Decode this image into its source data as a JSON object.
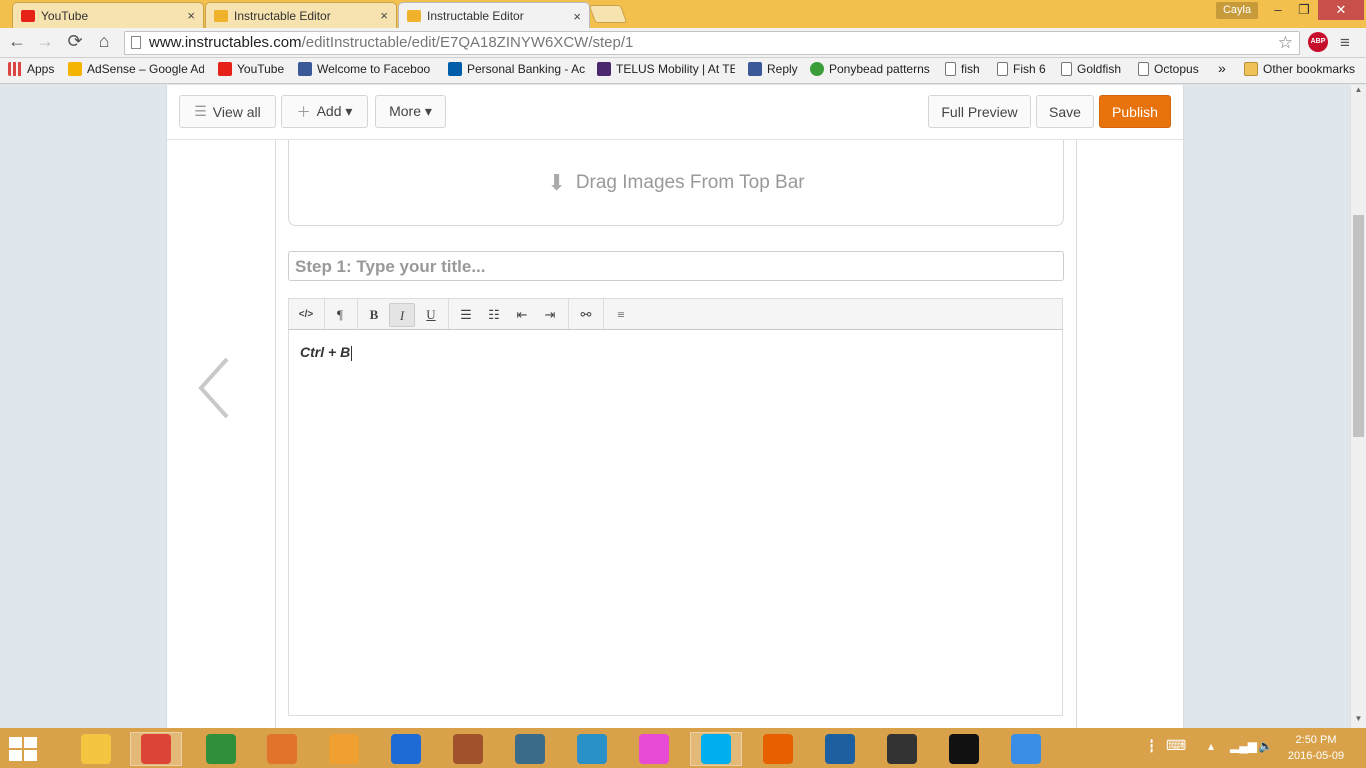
{
  "browser": {
    "tabs": [
      {
        "title": "YouTube",
        "close": "×",
        "favicon_color": "#e62117"
      },
      {
        "title": "Instructable Editor",
        "close": "×",
        "favicon_color": "#f0b12b"
      },
      {
        "title": "Instructable Editor",
        "close": "×",
        "favicon_color": "#f0b12b",
        "active": true
      }
    ],
    "user": "Cayla",
    "window_controls": {
      "minimize": "–",
      "restore": "❐",
      "close": "✕"
    },
    "nav": {
      "back": "←",
      "forward": "→",
      "reload": "⟳",
      "home": "⌂"
    },
    "url": {
      "host": "www.instructables.com",
      "path": "/editInstructable/edit/E7QA18ZINYW6XCW/step/1"
    },
    "star": "☆",
    "abp": "ABP",
    "menu": "≡",
    "bookmarks": [
      {
        "label": "Apps",
        "icon": "apps-grid-icon",
        "color": "#d44"
      },
      {
        "label": "AdSense – Google Ad",
        "icon": "adsense-icon",
        "color": "#f4b400"
      },
      {
        "label": "YouTube",
        "icon": "youtube-icon",
        "color": "#e62117"
      },
      {
        "label": "Welcome to Faceboo",
        "icon": "facebook-icon",
        "color": "#3b5998"
      },
      {
        "label": "Personal Banking - Ac",
        "icon": "rbc-icon",
        "color": "#005daa"
      },
      {
        "label": "TELUS Mobility | At TE",
        "icon": "telus-icon",
        "color": "#4b286d"
      },
      {
        "label": "Reply",
        "icon": "facebook-icon",
        "color": "#3b5998"
      },
      {
        "label": "Ponybead patterns",
        "icon": "ponybead-icon",
        "color": "#3a9d3a"
      },
      {
        "label": "fish",
        "icon": "page-icon",
        "color": "#ffffff"
      },
      {
        "label": "Fish 6",
        "icon": "page-icon",
        "color": "#ffffff"
      },
      {
        "label": "Goldfish",
        "icon": "page-icon",
        "color": "#ffffff"
      },
      {
        "label": "Octopus",
        "icon": "page-icon",
        "color": "#ffffff"
      }
    ],
    "more_bookmarks": "»",
    "other_bookmarks": "Other bookmarks"
  },
  "editor": {
    "view_all": "View all",
    "add": "Add ▾",
    "more": "More ▾",
    "full_preview": "Full Preview",
    "save": "Save",
    "publish": "Publish",
    "publish_color": "#e8720c",
    "drop_zone": "Drag Images From Top Bar",
    "title_placeholder": "Step 1:  Type your title...",
    "rte_tools": [
      {
        "name": "source-code-button",
        "glyph": "</>"
      },
      {
        "name": "paragraph-button",
        "glyph": "¶"
      },
      {
        "name": "bold-button",
        "glyph": "B"
      },
      {
        "name": "italic-button",
        "glyph": "I",
        "active": true
      },
      {
        "name": "underline-button",
        "glyph": "U"
      },
      {
        "name": "unordered-list-button",
        "glyph": "☰"
      },
      {
        "name": "ordered-list-button",
        "glyph": "☷"
      },
      {
        "name": "outdent-button",
        "glyph": "⇤"
      },
      {
        "name": "indent-button",
        "glyph": "⇥"
      },
      {
        "name": "link-button",
        "glyph": "⚯"
      },
      {
        "name": "align-button",
        "glyph": "≡"
      }
    ],
    "body_text": "Ctrl + B"
  },
  "taskbar": {
    "apps": [
      {
        "name": "file-explorer-icon",
        "color": "#f5c542"
      },
      {
        "name": "chrome-icon",
        "color": "#db4437",
        "active": true
      },
      {
        "name": "wps-writer-icon",
        "color": "#2f8f3a"
      },
      {
        "name": "app-tiles-icon",
        "color": "#e0742b"
      },
      {
        "name": "media-player-icon",
        "color": "#f0a030"
      },
      {
        "name": "malwarebytes-icon",
        "color": "#1f6bd6"
      },
      {
        "name": "store-icon",
        "color": "#a0522d"
      },
      {
        "name": "movie-maker-icon",
        "color": "#3a6b8a"
      },
      {
        "name": "fish-app-icon",
        "color": "#2a90c8"
      },
      {
        "name": "itunes-icon",
        "color": "#e94ad4"
      },
      {
        "name": "skype-icon",
        "color": "#00aff0",
        "active": true
      },
      {
        "name": "firefox-icon",
        "color": "#e66000"
      },
      {
        "name": "remote-desktop-icon",
        "color": "#1e5fa0"
      },
      {
        "name": "hypercam-icon",
        "color": "#333333"
      },
      {
        "name": "video-player-icon",
        "color": "#111111"
      },
      {
        "name": "safari-icon",
        "color": "#3a8ee6"
      }
    ],
    "time": "2:50 PM",
    "date": "2016-05-09"
  }
}
